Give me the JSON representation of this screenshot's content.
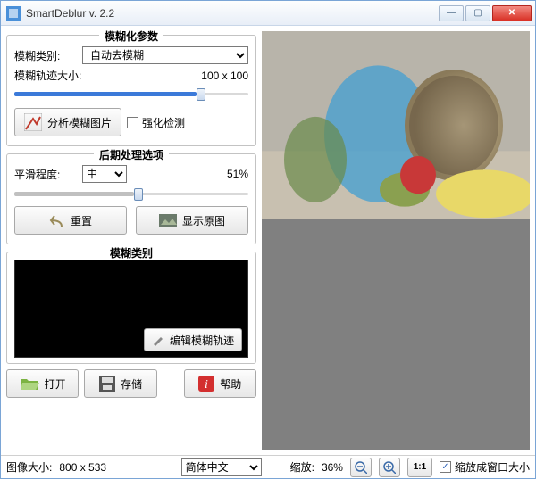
{
  "window": {
    "title": "SmartDeblur v. 2.2"
  },
  "groups": {
    "blur_params": "模糊化参数",
    "post_proc": "后期处理选项",
    "blur_type_group": "模糊类别"
  },
  "labels": {
    "blur_type": "模糊类别:",
    "kernel_size": "模糊轨迹大小:",
    "smoothness": "平滑程度:"
  },
  "combos": {
    "blur_type_value": "自动去模糊",
    "smooth_value": "中",
    "language": "简体中文"
  },
  "values": {
    "kernel_size": "100 x 100",
    "smooth_pct": "51%"
  },
  "buttons": {
    "analyze": "分析模糊图片",
    "enhance_detect": "强化检测",
    "reset": "重置",
    "show_original": "显示原图",
    "edit_kernel": "编辑模糊轨迹",
    "open": "打开",
    "save": "存储",
    "help": "帮助"
  },
  "status": {
    "image_size_label": "图像大小:",
    "image_size_value": "800 x 533",
    "zoom_label": "缩放:",
    "zoom_value": "36%",
    "one_to_one": "1:1",
    "fit_window": "缩放成窗口大小"
  },
  "checks": {
    "enhance_detect": false,
    "fit_window": true
  }
}
